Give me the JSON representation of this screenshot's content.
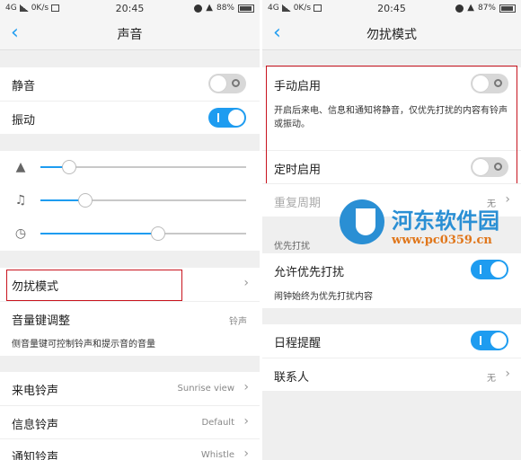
{
  "status_bar": {
    "left": {
      "network": "4G",
      "speed": "0K/s"
    },
    "time": "20:45",
    "right": {
      "battery_left": "88%",
      "battery_right": "87%"
    }
  },
  "sound_screen": {
    "title": "声音",
    "mute_label": "静音",
    "mute_on": false,
    "vibrate_label": "振动",
    "vibrate_on": true,
    "volume_levels": {
      "ring": 0.14,
      "media": 0.22,
      "alarm": 0.57
    },
    "dnd_label": "勿扰模式",
    "volume_key_label": "音量键调整",
    "volume_key_value": "铃声",
    "volume_key_hint": "侧音量键可控制铃声和提示音的音量",
    "ringtones": [
      {
        "label": "来电铃声",
        "value": "Sunrise view"
      },
      {
        "label": "信息铃声",
        "value": "Default"
      },
      {
        "label": "通知铃声",
        "value": "Whistle"
      }
    ]
  },
  "dnd_screen": {
    "title": "勿扰模式",
    "manual_label": "手动启用",
    "manual_on": false,
    "manual_hint": "开启后来电、信息和通知将静音，仅优先打扰的内容有铃声或振动。",
    "scheduled_label": "定时启用",
    "scheduled_on": false,
    "repeat_label": "重复周期",
    "repeat_value": "无",
    "priority_section": "优先打扰",
    "allow_priority_label": "允许优先打扰",
    "allow_priority_on": true,
    "allow_priority_hint": "闹钟始终为优先打扰内容",
    "calendar_label": "日程提醒",
    "calendar_on": true,
    "contacts_label": "联系人",
    "contacts_value": "无"
  },
  "watermark": {
    "name": "河东软件园",
    "url": "www.pc0359.cn"
  },
  "colors": {
    "accent": "#1e9cf0",
    "highlight_box": "#c8141e",
    "background": "#efefef"
  }
}
